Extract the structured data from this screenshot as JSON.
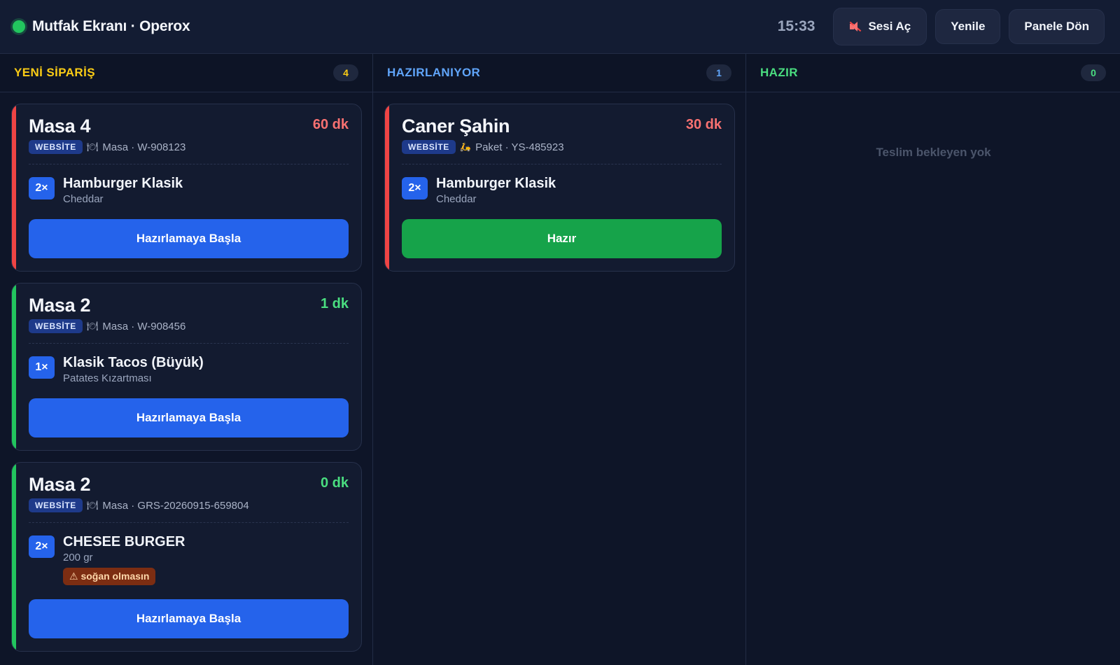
{
  "header": {
    "title": "Mutfak Ekranı · Operox",
    "clock": "15:33",
    "sound_label": "Sesi Aç",
    "refresh_label": "Yenile",
    "back_label": "Panele Dön",
    "status_color": "#22c55e"
  },
  "columns": [
    {
      "title": "YENİ SİPARİŞ",
      "count": "4",
      "color": "#facc15",
      "orders": [
        {
          "name": "Masa 4",
          "time": "60 dk",
          "time_color": "#f87171",
          "accent": "#ef4444",
          "badge": "WEBSİTE",
          "type_icon": "plate-icon",
          "meta": "Masa · W-908123",
          "items": [
            {
              "qty": "2×",
              "name": "Hamburger Klasik",
              "sub": "Cheddar",
              "note": ""
            }
          ],
          "action": "Hazırlamaya Başla"
        },
        {
          "name": "Masa 2",
          "time": "1 dk",
          "time_color": "#4ade80",
          "accent": "#22c55e",
          "badge": "WEBSİTE",
          "type_icon": "plate-icon",
          "meta": "Masa · W-908456",
          "items": [
            {
              "qty": "1×",
              "name": "Klasik Tacos (Büyük)",
              "sub": "Patates Kızartması",
              "note": ""
            }
          ],
          "action": "Hazırlamaya Başla"
        },
        {
          "name": "Masa 2",
          "time": "0 dk",
          "time_color": "#4ade80",
          "accent": "#22c55e",
          "badge": "WEBSİTE",
          "type_icon": "plate-icon",
          "meta": "Masa · GRS-20260915-659804",
          "items": [
            {
              "qty": "2×",
              "name": "CHESEE BURGER",
              "sub": "200 gr",
              "note": "⚠ soğan olmasın"
            }
          ],
          "action": "Hazırlamaya Başla"
        }
      ]
    },
    {
      "title": "HAZIRLANIYOR",
      "count": "1",
      "color": "#60a5fa",
      "orders": [
        {
          "name": "Caner Şahin",
          "time": "30 dk",
          "time_color": "#f87171",
          "accent": "#ef4444",
          "badge": "WEBSİTE",
          "type_icon": "scooter-icon",
          "meta": "Paket · YS-485923",
          "items": [
            {
              "qty": "2×",
              "name": "Hamburger Klasik",
              "sub": "Cheddar",
              "note": ""
            }
          ],
          "action": "Hazır"
        }
      ]
    },
    {
      "title": "HAZIR",
      "count": "0",
      "color": "#4ade80",
      "orders": [],
      "empty_text": "Teslim bekleyen yok"
    }
  ]
}
